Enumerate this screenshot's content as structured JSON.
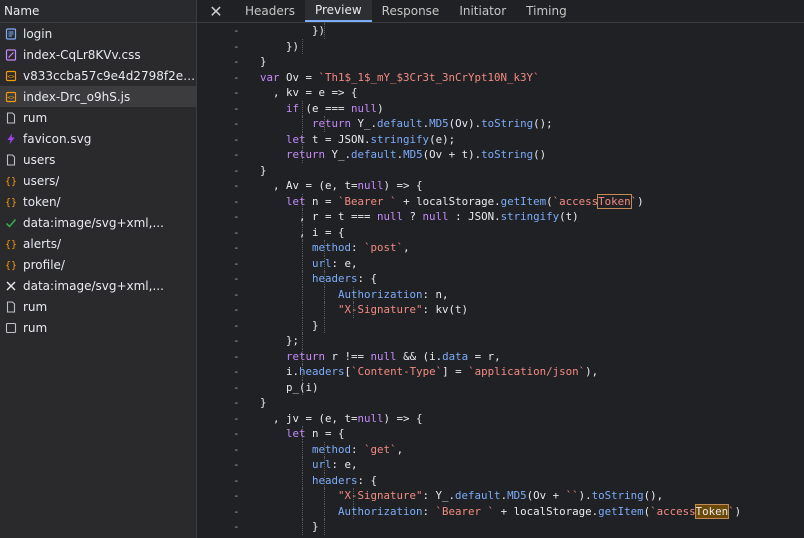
{
  "sidebar": {
    "header": "Name",
    "items": [
      {
        "label": "login",
        "icon": "document-icon"
      },
      {
        "label": "index-CqLr8KVv.css",
        "icon": "stylesheet-icon"
      },
      {
        "label": "v833ccba57c9e4d2798f2e76c...",
        "icon": "script-icon"
      },
      {
        "label": "index-Drc_o9hS.js",
        "icon": "script-icon",
        "selected": true
      },
      {
        "label": "rum",
        "icon": "file-icon"
      },
      {
        "label": "favicon.svg",
        "icon": "image-icon"
      },
      {
        "label": "users",
        "icon": "file-icon"
      },
      {
        "label": "users/",
        "icon": "fetch-icon"
      },
      {
        "label": "token/",
        "icon": "fetch-icon"
      },
      {
        "label": "data:image/svg+xml,...",
        "icon": "check-icon"
      },
      {
        "label": "alerts/",
        "icon": "fetch-icon"
      },
      {
        "label": "profile/",
        "icon": "fetch-icon"
      },
      {
        "label": "data:image/svg+xml,...",
        "icon": "cross-icon"
      },
      {
        "label": "rum",
        "icon": "file-icon"
      },
      {
        "label": "rum",
        "icon": "checkbox-icon"
      }
    ]
  },
  "tabs": {
    "close": "✕",
    "items": [
      "Headers",
      "Preview",
      "Response",
      "Initiator",
      "Timing"
    ],
    "active": 1
  },
  "colors": {
    "keyword": "#c58af9",
    "string": "#f28b82",
    "property": "#7cacf8",
    "text": "#e8eaed",
    "accent": "#7cacf8"
  },
  "code": [
    {
      "g": "-",
      "guides": [
        3
      ],
      "t": [
        [
          "        ",
          ""
        ],
        [
          "})",
          "n"
        ]
      ]
    },
    {
      "g": "-",
      "guides": [
        2
      ],
      "t": [
        [
          "    ",
          ""
        ],
        [
          "})",
          "n"
        ]
      ]
    },
    {
      "g": "-",
      "guides": [],
      "t": [
        [
          "}",
          "n"
        ]
      ]
    },
    {
      "g": "-",
      "guides": [],
      "t": [
        [
          "var ",
          "k"
        ],
        [
          "Ov = ",
          "n"
        ],
        [
          "`Th1$_1$_mY_$3Cr3t_3nCrYpt10N_k3Y`",
          "s"
        ]
      ]
    },
    {
      "g": "-",
      "guides": [],
      "t": [
        [
          "  , kv = e => {",
          "n"
        ]
      ]
    },
    {
      "g": "-",
      "guides": [
        2
      ],
      "t": [
        [
          "    ",
          ""
        ],
        [
          "if ",
          "k"
        ],
        [
          "(e === ",
          "n"
        ],
        [
          "null",
          "k"
        ],
        [
          ")",
          "n"
        ]
      ]
    },
    {
      "g": "-",
      "guides": [
        2,
        3
      ],
      "t": [
        [
          "        ",
          ""
        ],
        [
          "return ",
          "k"
        ],
        [
          "Y_.",
          "n"
        ],
        [
          "default",
          "p"
        ],
        [
          ".",
          "n"
        ],
        [
          "MD5",
          "p"
        ],
        [
          "(Ov).",
          "n"
        ],
        [
          "toString",
          "p"
        ],
        [
          "();",
          "n"
        ]
      ]
    },
    {
      "g": "-",
      "guides": [
        2
      ],
      "t": [
        [
          "    ",
          ""
        ],
        [
          "let ",
          "k"
        ],
        [
          "t = JSON.",
          "n"
        ],
        [
          "stringify",
          "p"
        ],
        [
          "(e);",
          "n"
        ]
      ]
    },
    {
      "g": "-",
      "guides": [
        2
      ],
      "t": [
        [
          "    ",
          ""
        ],
        [
          "return ",
          "k"
        ],
        [
          "Y_.",
          "n"
        ],
        [
          "default",
          "p"
        ],
        [
          ".",
          "n"
        ],
        [
          "MD5",
          "p"
        ],
        [
          "(Ov + t).",
          "n"
        ],
        [
          "toString",
          "p"
        ],
        [
          "()",
          "n"
        ]
      ]
    },
    {
      "g": "-",
      "guides": [],
      "t": [
        [
          "}",
          "n"
        ]
      ]
    },
    {
      "g": "-",
      "guides": [],
      "t": [
        [
          "  , Av = (e, t=",
          "n"
        ],
        [
          "null",
          "k"
        ],
        [
          ") => {",
          "n"
        ]
      ]
    },
    {
      "g": "-",
      "guides": [
        2
      ],
      "t": [
        [
          "    ",
          ""
        ],
        [
          "let ",
          "k"
        ],
        [
          "n = ",
          "n"
        ],
        [
          "`Bearer ` ",
          "s"
        ],
        [
          "+ localStorage.",
          "n"
        ],
        [
          "getItem",
          "p"
        ],
        [
          "(",
          "n"
        ],
        [
          "`access",
          "s"
        ],
        [
          "Token",
          "s",
          "box"
        ],
        [
          "`",
          "s"
        ],
        [
          ")",
          "n"
        ]
      ]
    },
    {
      "g": "-",
      "guides": [
        2
      ],
      "t": [
        [
          "      , r = t === ",
          "n"
        ],
        [
          "null ",
          "k"
        ],
        [
          "? ",
          "n"
        ],
        [
          "null ",
          "k"
        ],
        [
          ": JSON.",
          "n"
        ],
        [
          "stringify",
          "p"
        ],
        [
          "(t)",
          "n"
        ]
      ]
    },
    {
      "g": "-",
      "guides": [
        2
      ],
      "t": [
        [
          "      , i = {",
          "n"
        ]
      ]
    },
    {
      "g": "-",
      "guides": [
        2,
        3
      ],
      "t": [
        [
          "        ",
          ""
        ],
        [
          "method",
          "p"
        ],
        [
          ": ",
          "n"
        ],
        [
          "`post`",
          "s"
        ],
        [
          ",",
          "n"
        ]
      ]
    },
    {
      "g": "-",
      "guides": [
        2,
        3
      ],
      "t": [
        [
          "        ",
          ""
        ],
        [
          "url",
          "p"
        ],
        [
          ": e,",
          "n"
        ]
      ]
    },
    {
      "g": "-",
      "guides": [
        2,
        3
      ],
      "t": [
        [
          "        ",
          ""
        ],
        [
          "headers",
          "p"
        ],
        [
          ": {",
          "n"
        ]
      ]
    },
    {
      "g": "-",
      "guides": [
        2,
        3,
        4
      ],
      "t": [
        [
          "            ",
          ""
        ],
        [
          "Authorization",
          "p"
        ],
        [
          ": n,",
          "n"
        ]
      ]
    },
    {
      "g": "-",
      "guides": [
        2,
        3,
        4
      ],
      "t": [
        [
          "            ",
          ""
        ],
        [
          "\"X-Signature\"",
          "s"
        ],
        [
          ": kv(t)",
          "n"
        ]
      ]
    },
    {
      "g": "-",
      "guides": [
        2,
        3
      ],
      "t": [
        [
          "        ",
          ""
        ],
        [
          "}",
          "n"
        ]
      ]
    },
    {
      "g": "-",
      "guides": [
        2
      ],
      "t": [
        [
          "    ",
          ""
        ],
        [
          "};",
          "n"
        ]
      ]
    },
    {
      "g": "-",
      "guides": [
        2
      ],
      "t": [
        [
          "    ",
          ""
        ],
        [
          "return ",
          "k"
        ],
        [
          "r !== ",
          "n"
        ],
        [
          "null ",
          "k"
        ],
        [
          "&& (i.",
          "n"
        ],
        [
          "data",
          "p"
        ],
        [
          " = r,",
          "n"
        ]
      ]
    },
    {
      "g": "-",
      "guides": [
        2
      ],
      "t": [
        [
          "    ",
          ""
        ],
        [
          "i.",
          "n"
        ],
        [
          "headers",
          "p"
        ],
        [
          "[",
          "n"
        ],
        [
          "`Content-Type`",
          "s"
        ],
        [
          "] = ",
          "n"
        ],
        [
          "`application/json`",
          "s"
        ],
        [
          "),",
          "n"
        ]
      ]
    },
    {
      "g": "-",
      "guides": [
        2
      ],
      "t": [
        [
          "    ",
          ""
        ],
        [
          "p_(i)",
          "n"
        ]
      ]
    },
    {
      "g": "-",
      "guides": [],
      "t": [
        [
          "}",
          "n"
        ]
      ]
    },
    {
      "g": "-",
      "guides": [],
      "t": [
        [
          "  , jv = (e, t=",
          "n"
        ],
        [
          "null",
          "k"
        ],
        [
          ") => {",
          "n"
        ]
      ]
    },
    {
      "g": "-",
      "guides": [
        2
      ],
      "t": [
        [
          "    ",
          ""
        ],
        [
          "let ",
          "k"
        ],
        [
          "n = {",
          "n"
        ]
      ]
    },
    {
      "g": "-",
      "guides": [
        2,
        3
      ],
      "t": [
        [
          "        ",
          ""
        ],
        [
          "method",
          "p"
        ],
        [
          ": ",
          "n"
        ],
        [
          "`get`",
          "s"
        ],
        [
          ",",
          "n"
        ]
      ]
    },
    {
      "g": "-",
      "guides": [
        2,
        3
      ],
      "t": [
        [
          "        ",
          ""
        ],
        [
          "url",
          "p"
        ],
        [
          ": e,",
          "n"
        ]
      ]
    },
    {
      "g": "-",
      "guides": [
        2,
        3
      ],
      "t": [
        [
          "        ",
          ""
        ],
        [
          "headers",
          "p"
        ],
        [
          ": {",
          "n"
        ]
      ]
    },
    {
      "g": "-",
      "guides": [
        2,
        3,
        4
      ],
      "t": [
        [
          "            ",
          ""
        ],
        [
          "\"X-Signature\"",
          "s"
        ],
        [
          ": Y_.",
          "n"
        ],
        [
          "default",
          "p"
        ],
        [
          ".",
          "n"
        ],
        [
          "MD5",
          "p"
        ],
        [
          "(Ov + ",
          "n"
        ],
        [
          "``",
          "s"
        ],
        [
          ").",
          "n"
        ],
        [
          "toString",
          "p"
        ],
        [
          "(),",
          "n"
        ]
      ]
    },
    {
      "g": "-",
      "guides": [
        2,
        3,
        4
      ],
      "t": [
        [
          "            ",
          ""
        ],
        [
          "Authorization",
          "p"
        ],
        [
          ": ",
          "n"
        ],
        [
          "`Bearer ` ",
          "s"
        ],
        [
          "+ localStorage.",
          "n"
        ],
        [
          "getItem",
          "p"
        ],
        [
          "(",
          "n"
        ],
        [
          "`access",
          "s"
        ],
        [
          "Token",
          "n",
          "fill"
        ],
        [
          "`",
          "s"
        ],
        [
          ")",
          "n"
        ]
      ]
    },
    {
      "g": "-",
      "guides": [
        2,
        3
      ],
      "t": [
        [
          "        ",
          ""
        ],
        [
          "}",
          "n"
        ]
      ]
    }
  ]
}
